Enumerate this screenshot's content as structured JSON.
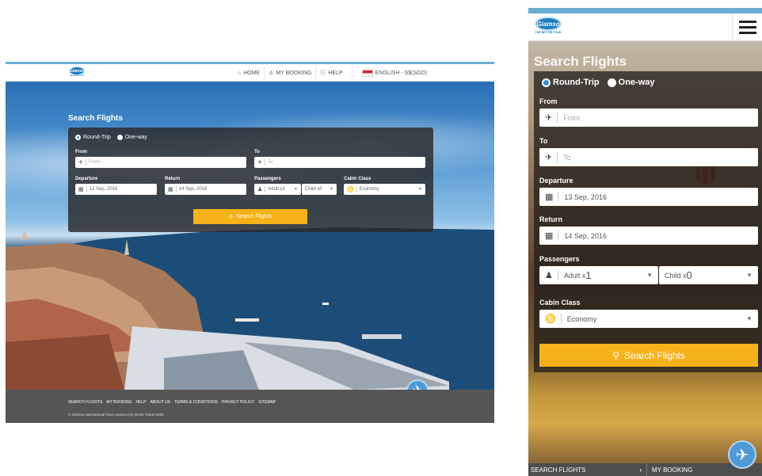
{
  "brand": {
    "logo_text": "Giamso",
    "tagline": "THE BETTER TOUR",
    "primary_color": "#1d7cc0",
    "accent_color": "#f6b21b",
    "topline_color": "#6aaed6"
  },
  "desktop": {
    "nav": {
      "home": "HOME",
      "my_booking": "MY BOOKING",
      "help": "HELP",
      "language": "ENGLISH - S$(SGD)"
    },
    "search": {
      "title": "Search Flights",
      "trip_types": [
        "Round-Trip",
        "One-way"
      ],
      "selected_trip": "Round-Trip",
      "from_label": "From",
      "from_placeholder": "From",
      "to_label": "To",
      "to_placeholder": "To",
      "departure_label": "Departure",
      "departure_value": "13 Sep, 2016",
      "return_label": "Return",
      "return_value": "14 Sep, 2016",
      "passengers_label": "Passengers",
      "adult_value": "Adult x1",
      "child_value": "Child x0",
      "cabin_label": "Cabin Class",
      "cabin_value": "Economy",
      "button_label": "Search Flights"
    },
    "footer": {
      "links": [
        "SEARCH FLIGHTS",
        "MY BOOKING",
        "HELP",
        "ABOUT US",
        "TERMS & CONDITIONS",
        "PRIVACY POLICY",
        "SITEMAP"
      ],
      "copyright": "© Giamso International Tours powered by DeNA Travel 2016"
    }
  },
  "mobile": {
    "search": {
      "title": "Search Flights",
      "trip_types": [
        "Round-Trip",
        "One-way"
      ],
      "selected_trip": "Round-Trip",
      "from_label": "From",
      "from_placeholder": "From",
      "to_label": "To",
      "to_placeholder": "To",
      "departure_label": "Departure",
      "departure_value": "13 Sep, 2016",
      "return_label": "Return",
      "return_value": "14 Sep, 2016",
      "passengers_label": "Passengers",
      "adult_prefix": "Adult x",
      "adult_count": "1",
      "child_prefix": "Child x",
      "child_count": "0",
      "cabin_label": "Cabin Class",
      "cabin_value": "Economy",
      "button_label": "Search Flights"
    },
    "footer": {
      "item1": "SEARCH FLIGHTS",
      "item2": "MY BOOKING"
    }
  }
}
